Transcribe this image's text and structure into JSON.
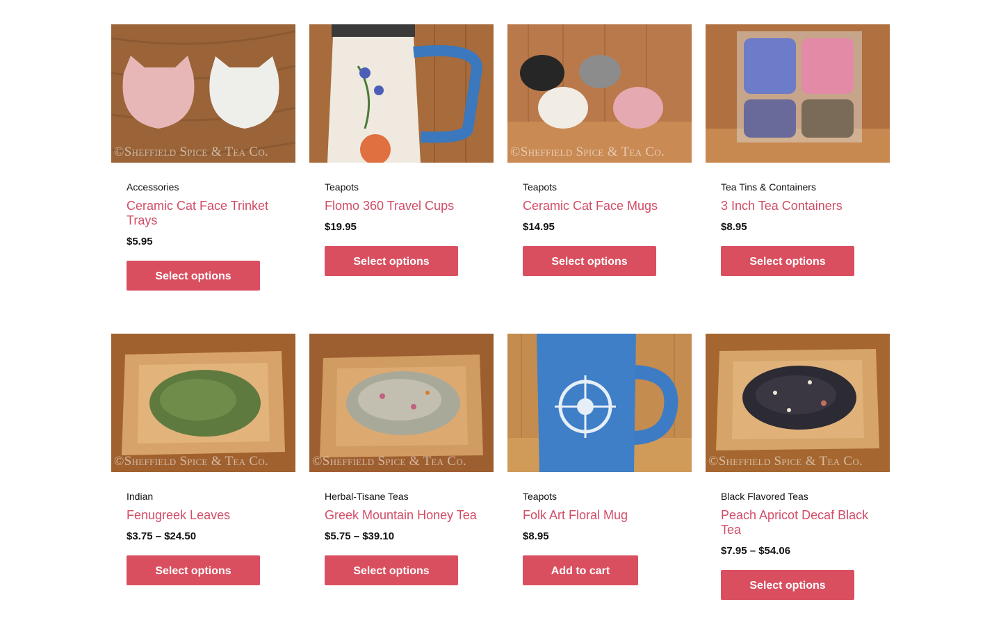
{
  "products": [
    {
      "category": "Accessories",
      "title": "Ceramic Cat Face Trinket Trays",
      "price": "$5.95",
      "button": "Select options",
      "watermark": "©Sheffield Spice & Tea Co.",
      "bg": "#9a6438"
    },
    {
      "category": "Teapots",
      "title": "Flomo 360 Travel Cups",
      "price": "$19.95",
      "button": "Select options",
      "watermark": "",
      "bg": "#a86b3b"
    },
    {
      "category": "Teapots",
      "title": "Ceramic Cat Face Mugs",
      "price": "$14.95",
      "button": "Select options",
      "watermark": "©Sheffield Spice & Tea Co.",
      "bg": "#b9794a"
    },
    {
      "category": "Tea Tins & Containers",
      "title": "3 Inch Tea Containers",
      "price": "$8.95",
      "button": "Select options",
      "watermark": "",
      "bg": "#b07040"
    },
    {
      "category": "Indian",
      "title": "Fenugreek Leaves",
      "price": "$3.75 – $24.50",
      "button": "Select options",
      "watermark": "©Sheffield Spice & Tea Co.",
      "bg": "#a0612f"
    },
    {
      "category": "Herbal-Tisane Teas",
      "title": "Greek Mountain Honey Tea",
      "price": "$5.75 – $39.10",
      "button": "Select options",
      "watermark": "©Sheffield Spice & Tea Co.",
      "bg": "#9e5f30"
    },
    {
      "category": "Teapots",
      "title": "Folk Art Floral Mug",
      "price": "$8.95",
      "button": "Add to cart",
      "watermark": "",
      "bg": "#c48c4e"
    },
    {
      "category": "Black Flavored Teas",
      "title": "Peach Apricot Decaf Black Tea",
      "price": "$7.95 – $54.06",
      "button": "Select options",
      "watermark": "©Sheffield Spice & Tea Co.",
      "bg": "#a5672f"
    }
  ],
  "colors": {
    "accent": "#d24c66",
    "button": "#d94f5f"
  }
}
